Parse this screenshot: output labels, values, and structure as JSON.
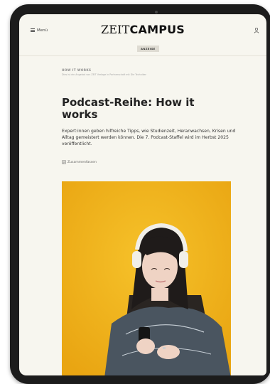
{
  "header": {
    "menu_label": "Menü",
    "logo_zeit": "ZEIT",
    "logo_campus": "CAMPUS",
    "ad_badge": "ANZEIGE"
  },
  "article": {
    "kicker": "HOW IT WORKS",
    "subkicker": "Dies ist ein Angebot von ZEIT Verlage in Partnerschaft mit Die Techniker",
    "title": "Podcast-Reihe: How it works",
    "description": "Expert:innen geben hilfreiche Tipps, wie Studienzeit, Heranwachsen, Krisen und Alltag gemeistert werden können. Die 7. Podcast-Staffel wird im Herbst 2025 veröffentlicht.",
    "summary_label": "Zusammenfassen"
  },
  "colors": {
    "page_background": "#f7f6ef",
    "hero_background": "#f0b21c",
    "device_frame": "#1c1c1c"
  },
  "icons": [
    "hamburger-icon",
    "user-icon",
    "summary-icon"
  ]
}
